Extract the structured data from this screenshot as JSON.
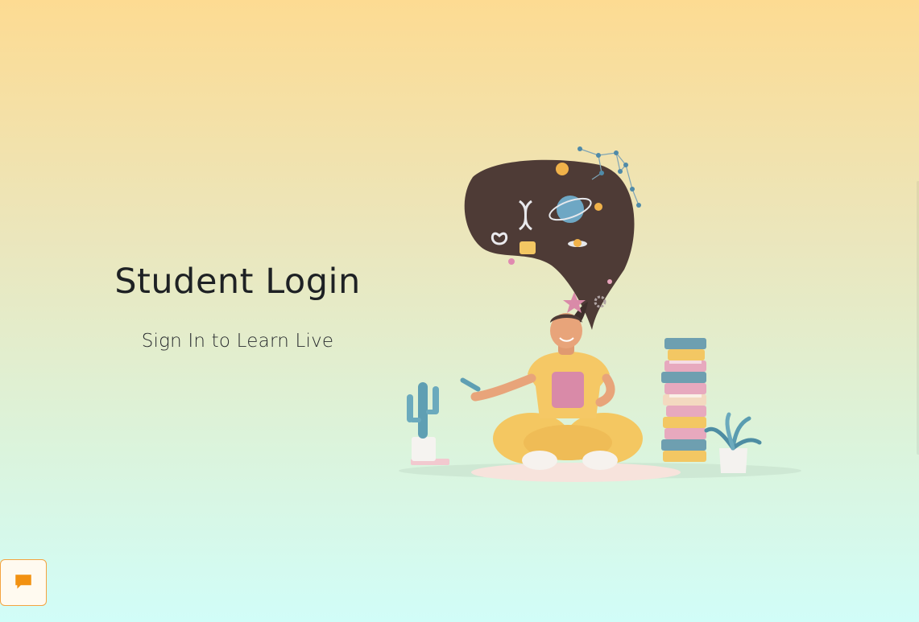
{
  "page": {
    "title": "Student Login",
    "subtitle": "Sign In to Learn Live"
  },
  "illustration": {
    "icon": "student-with-tablet-illustration"
  },
  "chat": {
    "icon": "chat-bubble-icon",
    "color": "#f29111"
  },
  "colors": {
    "gradient_top": "#fddb92",
    "gradient_bottom": "#d1fdf8",
    "accent": "#f29111"
  }
}
